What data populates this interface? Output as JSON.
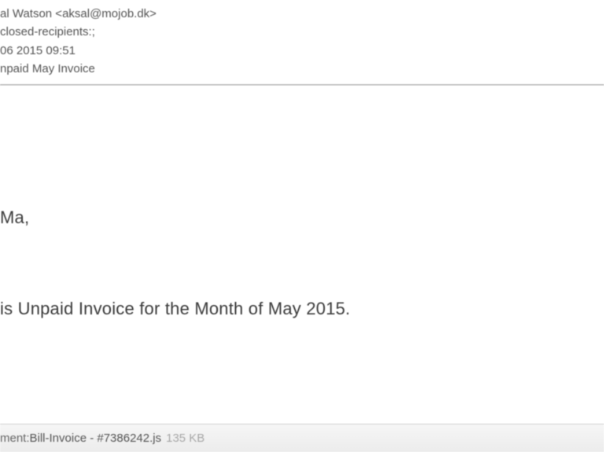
{
  "header": {
    "from": "al Watson <aksal@mojob.dk>",
    "to": "closed-recipients:;",
    "date": "06 2015 09:51",
    "subject": "npaid May Invoice"
  },
  "body": {
    "greeting": "Ma,",
    "message": "is Unpaid Invoice for the Month of May 2015."
  },
  "attachment": {
    "label_prefix": "ment: ",
    "filename": "Bill-Invoice - #7386242.js",
    "size": "135 KB"
  }
}
